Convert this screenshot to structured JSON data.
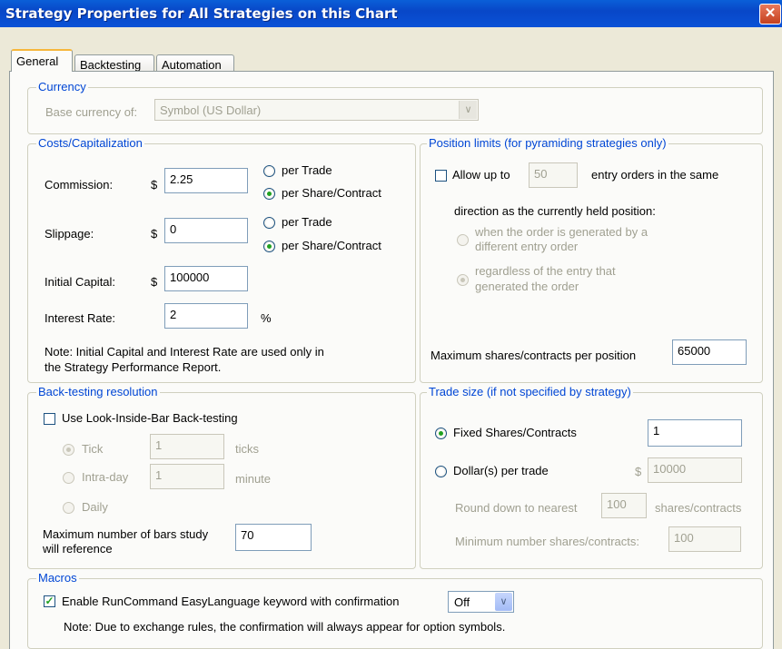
{
  "window": {
    "title": "Strategy Properties for All Strategies on this Chart",
    "close_glyph": "✕"
  },
  "tabs": [
    {
      "label": "General",
      "active": true
    },
    {
      "label": "Backtesting",
      "active": false
    },
    {
      "label": "Automation",
      "active": false
    }
  ],
  "currency": {
    "legend": "Currency",
    "base_label": "Base currency of:",
    "base_value": "Symbol (US Dollar)"
  },
  "costs": {
    "legend": "Costs/Capitalization",
    "commission_label": "Commission:",
    "slippage_label": "Slippage:",
    "initial_capital_label": "Initial Capital:",
    "interest_rate_label": "Interest Rate:",
    "currency_symbol": "$",
    "percent_symbol": "%",
    "commission_value": "2.25",
    "slippage_value": "0",
    "initial_capital_value": "100000",
    "interest_rate_value": "2",
    "per_trade": "per Trade",
    "per_share": "per Share/Contract",
    "note_line1": "Note: Initial Capital and Interest Rate are used only in",
    "note_line2": "the Strategy Performance Report."
  },
  "position_limits": {
    "legend": "Position limits (for pyramiding strategies only)",
    "allow_label": "Allow up to",
    "allow_value": "50",
    "entry_suffix": "entry orders in the same",
    "direction_text": "direction as the currently held position:",
    "option1_line1": "when the order is generated by a",
    "option1_line2": "different entry order",
    "option2_line1": "regardless of the entry that",
    "option2_line2": "generated the order",
    "max_label": "Maximum shares/contracts per position",
    "max_value": "65000"
  },
  "backtesting": {
    "legend": "Back-testing resolution",
    "lib_label": "Use Look-Inside-Bar Back-testing",
    "tick_label": "Tick",
    "tick_value": "1",
    "tick_unit": "ticks",
    "intraday_label": "Intra-day",
    "intraday_value": "1",
    "intraday_unit": "minute",
    "daily_label": "Daily",
    "maxbars_line1": "Maximum number of bars study",
    "maxbars_line2": "will reference",
    "maxbars_value": "70"
  },
  "trade_size": {
    "legend": "Trade size (if not specified by strategy)",
    "fixed_label": "Fixed Shares/Contracts",
    "fixed_value": "1",
    "dollar_label": "Dollar(s) per trade",
    "dollar_symbol": "$",
    "dollar_value": "10000",
    "round_label": "Round down to nearest",
    "round_value": "100",
    "round_unit": "shares/contracts",
    "min_label": "Minimum number shares/contracts:",
    "min_value": "100"
  },
  "macros": {
    "legend": "Macros",
    "enable_label": "Enable RunCommand EasyLanguage keyword with confirmation",
    "confirm_value": "Off",
    "note": "Note: Due to exchange rules, the confirmation will always appear for option symbols."
  },
  "colors": {
    "legend": "#0046d5",
    "title_bar": "#0a52d6",
    "radio_dot": "#21a121"
  },
  "icons": {
    "close": "close-icon",
    "dropdown": "chevron-down-icon",
    "check": "checkmark-icon"
  }
}
